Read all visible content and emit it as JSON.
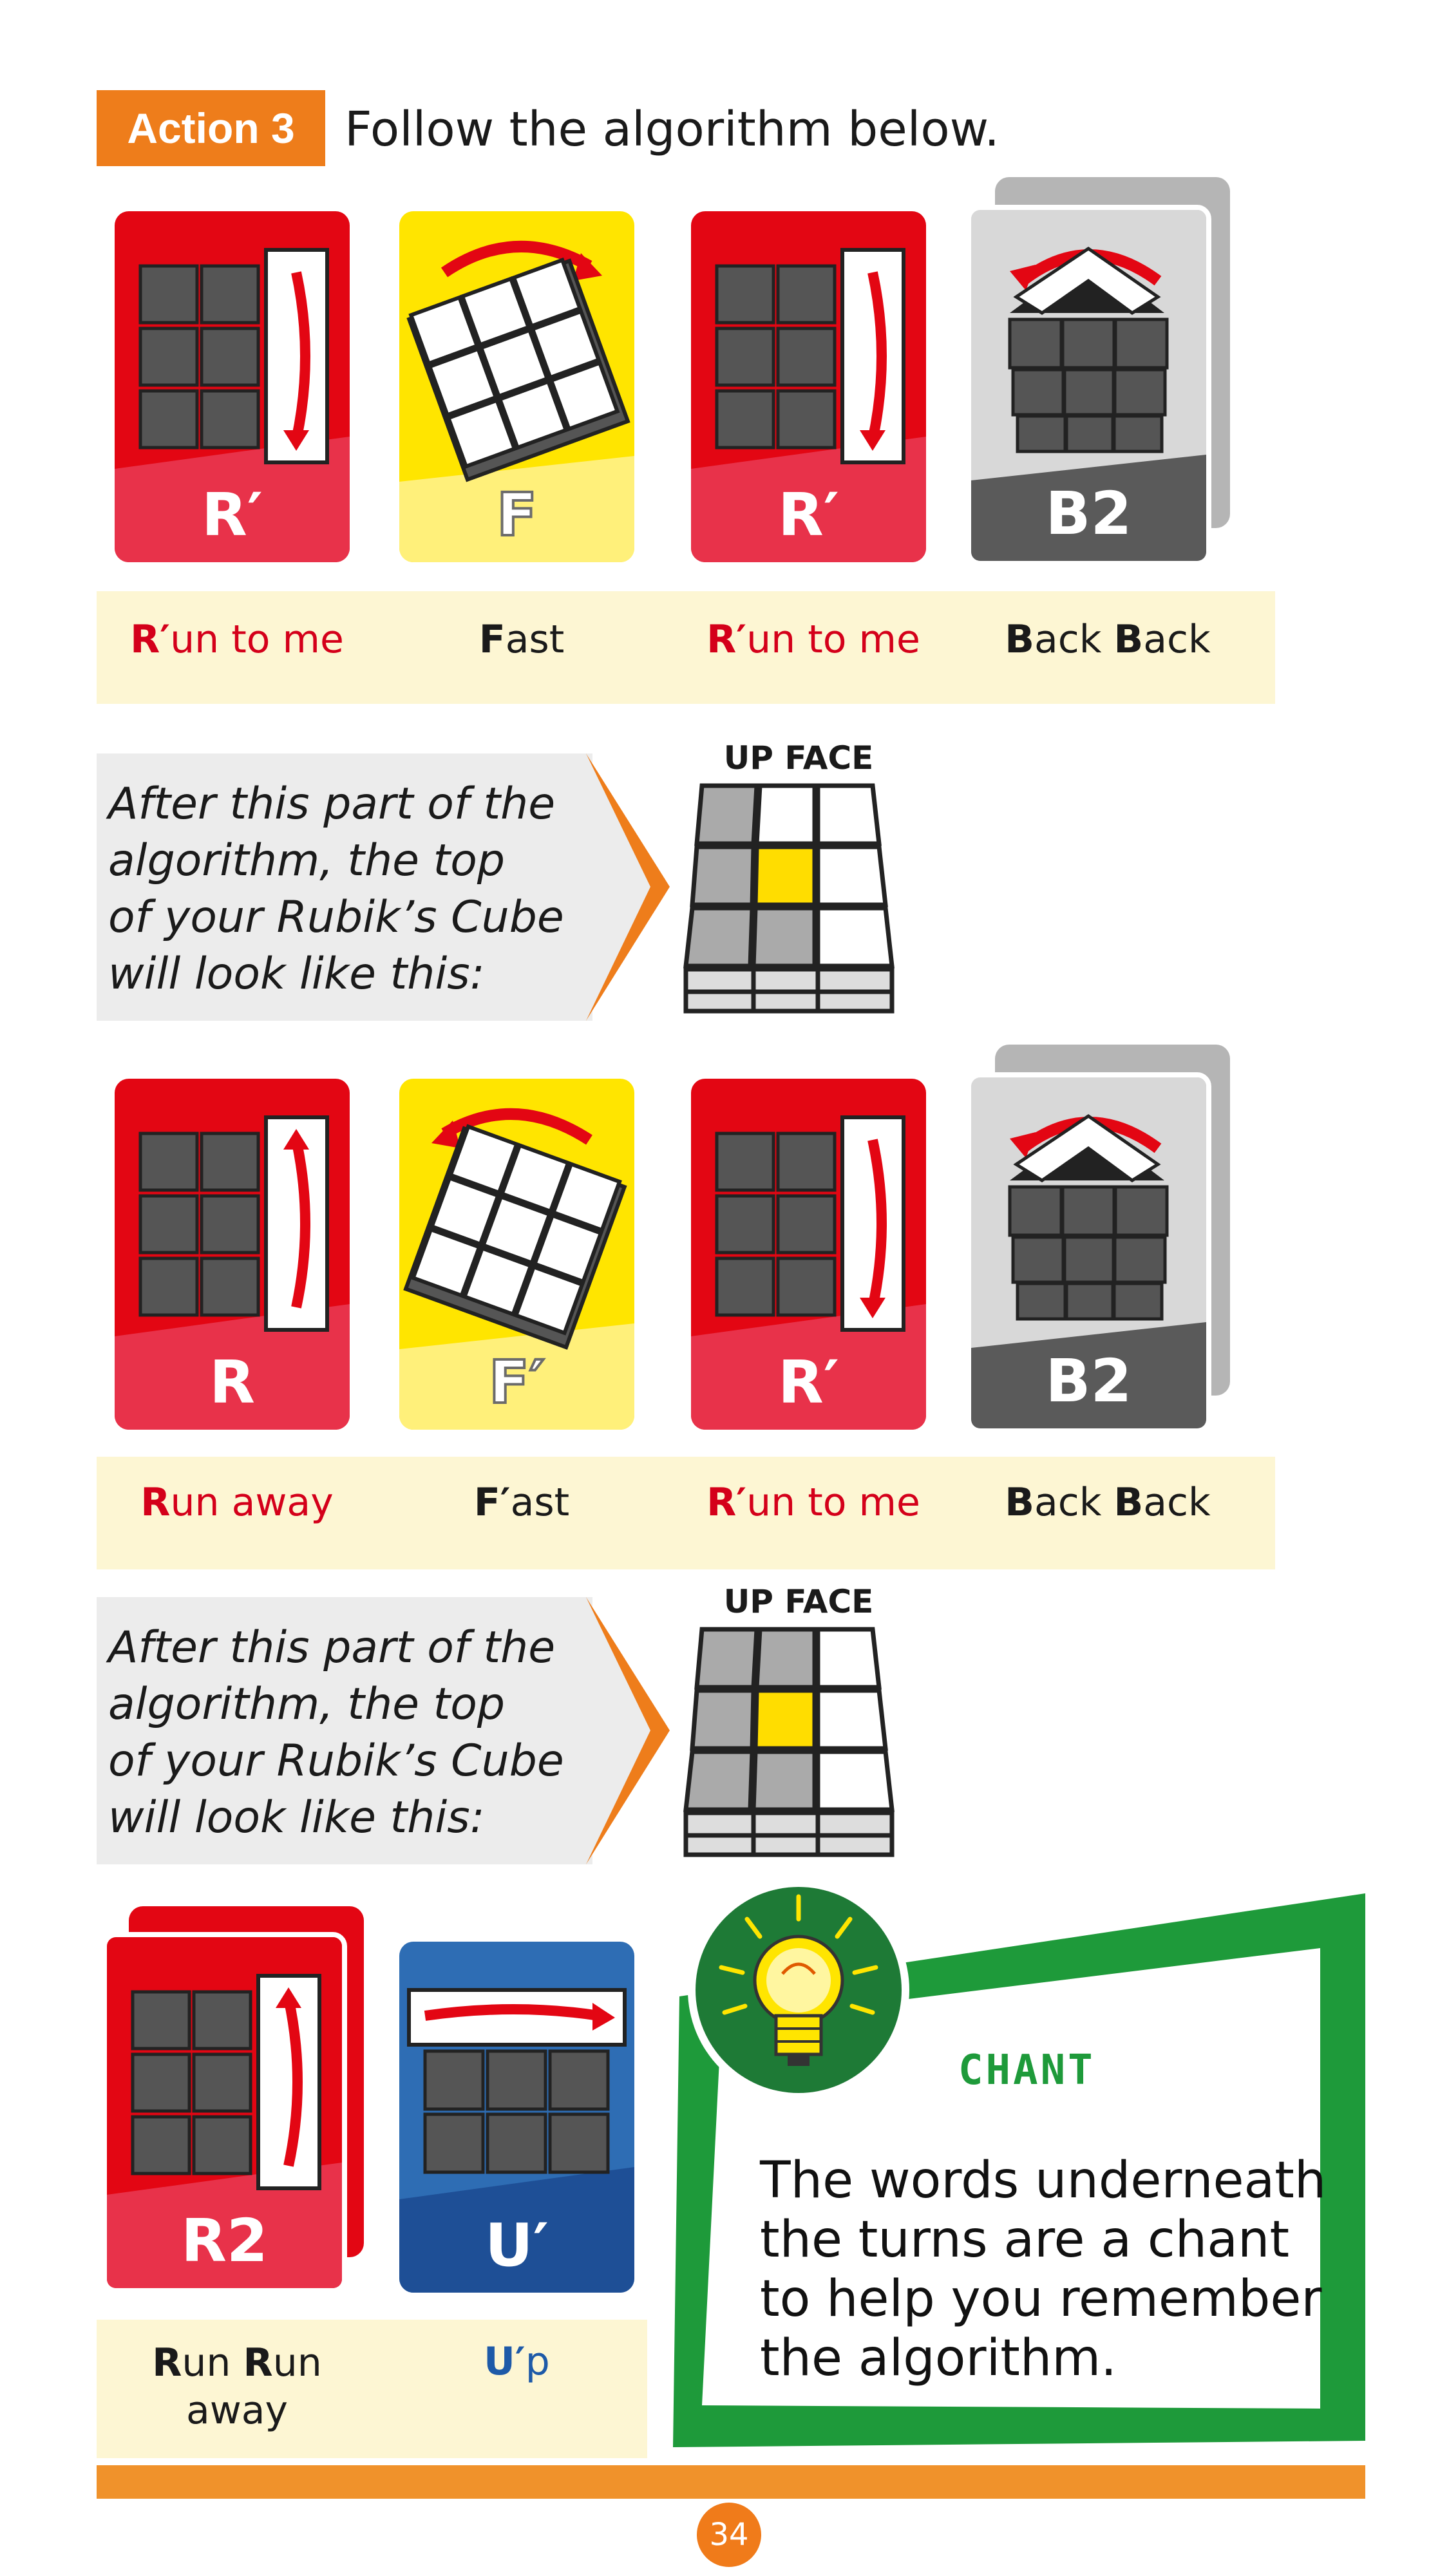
{
  "header": {
    "badge": "Action 3",
    "instruction": "Follow the algorithm below."
  },
  "row1": {
    "cards": [
      {
        "label": "R′",
        "color": "red",
        "icon": "right-face-down-arrow-icon"
      },
      {
        "label": "F",
        "color": "yellow",
        "icon": "front-clockwise-arrow-icon"
      },
      {
        "label": "R′",
        "color": "red",
        "icon": "right-face-down-arrow-icon"
      },
      {
        "label": "B2",
        "color": "gray",
        "icon": "back-turn-twice-icon"
      }
    ],
    "chants": [
      {
        "bold": "R′",
        "rest": "un to me"
      },
      {
        "bold": "F",
        "rest": "ast"
      },
      {
        "bold": "R′",
        "rest": "un to me"
      },
      {
        "bold1": "B",
        "mid": "ack ",
        "bold2": "B",
        "rest": "ack"
      }
    ]
  },
  "callout1": {
    "lines": [
      "After this part of the",
      "algorithm, the top",
      "of your Rubik’s Cube",
      "will look like this:"
    ],
    "upface_label": "UP FACE"
  },
  "row2": {
    "cards": [
      {
        "label": "R",
        "color": "red",
        "icon": "right-face-up-arrow-icon"
      },
      {
        "label": "F′",
        "color": "yellow",
        "icon": "front-counterclockwise-arrow-icon"
      },
      {
        "label": "R′",
        "color": "red",
        "icon": "right-face-down-arrow-icon"
      },
      {
        "label": "B2",
        "color": "gray",
        "icon": "back-turn-twice-icon"
      }
    ],
    "chants": [
      {
        "bold": "R",
        "rest": "un away"
      },
      {
        "bold": "F′",
        "rest": "ast"
      },
      {
        "bold": "R′",
        "rest": "un to me"
      },
      {
        "bold1": "B",
        "mid": "ack ",
        "bold2": "B",
        "rest": "ack"
      }
    ]
  },
  "callout2": {
    "lines": [
      "After this part of the",
      "algorithm, the top",
      "of your Rubik’s Cube",
      "will look like this:"
    ],
    "upface_label": "UP FACE"
  },
  "row3": {
    "cards": [
      {
        "label": "R2",
        "color": "red",
        "icon": "right-face-up-arrow-icon"
      },
      {
        "label": "U′",
        "color": "blue",
        "icon": "up-face-right-arrow-icon"
      }
    ],
    "chant_r2": {
      "bold1": "R",
      "mid": "un ",
      "bold2": "R",
      "rest": "un",
      "line2": "away"
    },
    "chant_u": {
      "bold": "U′",
      "rest": "p"
    }
  },
  "tip": {
    "title": "CHANT",
    "lines": [
      "The words underneath",
      "the turns are a chant",
      "to help you remember",
      "the algorithm."
    ],
    "icon": "lightbulb-icon"
  },
  "footer": {
    "page_number": "34"
  },
  "colors": {
    "orange": "#ee7d1b",
    "red": "#e30613",
    "yellow": "#ffe500",
    "gray": "#5a5a5a",
    "blue": "#1e5aa8",
    "green": "#1e9a3a"
  }
}
